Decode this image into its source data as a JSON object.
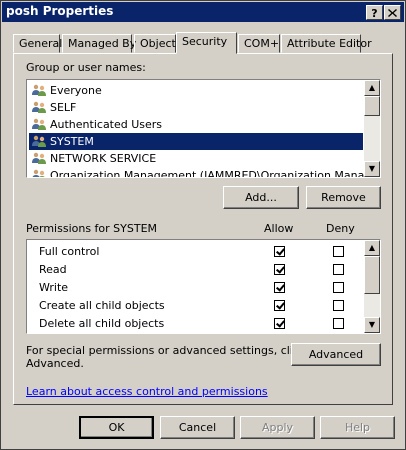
{
  "window": {
    "title": "posh Properties",
    "help_btn": "?",
    "close_btn": "X"
  },
  "tabs": [
    "General",
    "Managed By",
    "Object",
    "Security",
    "COM+",
    "Attribute Editor"
  ],
  "active_tab": "Security",
  "groups": {
    "label": "Group or user names:",
    "items": [
      {
        "name": "Everyone",
        "selected": false
      },
      {
        "name": "SELF",
        "selected": false
      },
      {
        "name": "Authenticated Users",
        "selected": false
      },
      {
        "name": "SYSTEM",
        "selected": true
      },
      {
        "name": "NETWORK SERVICE",
        "selected": false
      },
      {
        "name": "Organization Management (IAMMRED\\Organization Manageme...",
        "selected": false
      }
    ],
    "add_label": "Add...",
    "remove_label": "Remove"
  },
  "permissions": {
    "title": "Permissions for SYSTEM",
    "allow_header": "Allow",
    "deny_header": "Deny",
    "rows": [
      {
        "name": "Full control",
        "allow": true,
        "deny": false
      },
      {
        "name": "Read",
        "allow": true,
        "deny": false
      },
      {
        "name": "Write",
        "allow": true,
        "deny": false
      },
      {
        "name": "Create all child objects",
        "allow": true,
        "deny": false
      },
      {
        "name": "Delete all child objects",
        "allow": true,
        "deny": false
      }
    ]
  },
  "advanced": {
    "text_line1": "For special permissions or advanced settings, click",
    "text_line2": "Advanced.",
    "button_label": "Advanced"
  },
  "learn_link": "Learn about access control and permissions",
  "footer": {
    "ok": "OK",
    "cancel": "Cancel",
    "apply": "Apply",
    "help": "Help"
  }
}
